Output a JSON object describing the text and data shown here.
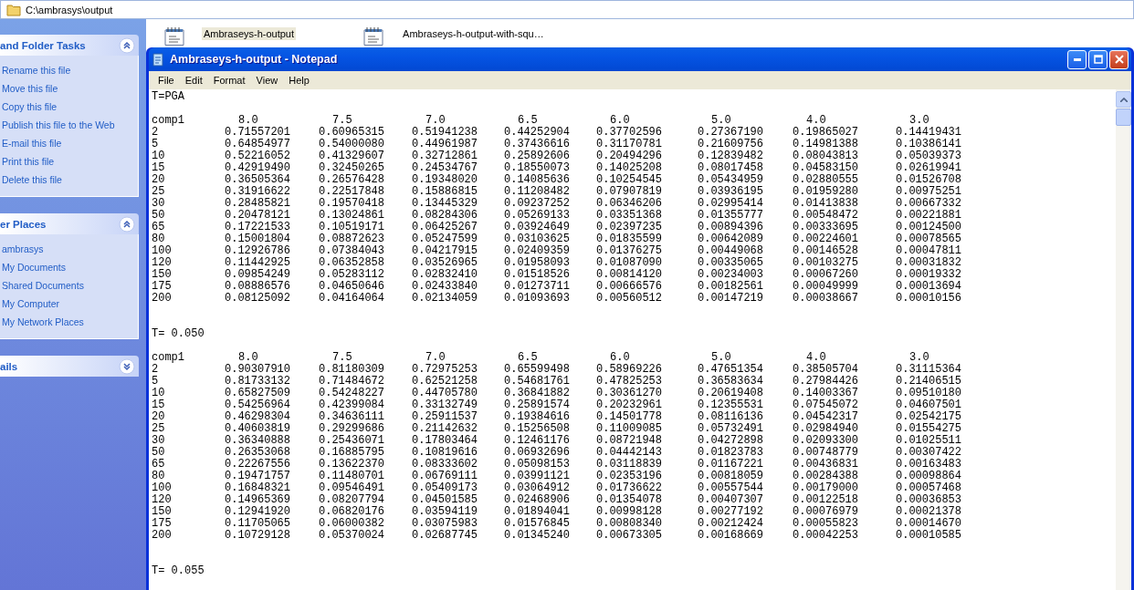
{
  "address_bar": {
    "path": "C:\\ambrasys\\output"
  },
  "task_panes": [
    {
      "title": "and Folder Tasks",
      "expanded": true,
      "items": [
        "Rename this file",
        "Move this file",
        "Copy this file",
        "Publish this file to the Web",
        "E-mail this file",
        "Print this file",
        "Delete this file"
      ]
    },
    {
      "title": "er Places",
      "expanded": true,
      "items": [
        "ambrasys",
        "My Documents",
        "Shared Documents",
        "My Computer",
        "My Network Places"
      ]
    },
    {
      "title": "ails",
      "expanded": false
    }
  ],
  "files": [
    {
      "name": "Ambraseys-h-output",
      "selected": true
    },
    {
      "name": "Ambraseys-h-output-with-squ…",
      "selected": false
    }
  ],
  "notepad": {
    "title": "Ambraseys-h-output - Notepad",
    "menu": [
      "File",
      "Edit",
      "Format",
      "View",
      "Help"
    ],
    "blocks": [
      {
        "heading": "T=PGA",
        "columns": [
          "comp1",
          "8.0",
          "7.5",
          "7.0",
          "6.5",
          "6.0",
          "5.0",
          "4.0",
          "3.0"
        ],
        "rows": [
          [
            "2",
            "0.71557201",
            "0.60965315",
            "0.51941238",
            "0.44252904",
            "0.37702596",
            "0.27367190",
            "0.19865027",
            "0.14419431"
          ],
          [
            "5",
            "0.64854977",
            "0.54000080",
            "0.44961987",
            "0.37436616",
            "0.31170781",
            "0.21609756",
            "0.14981388",
            "0.10386141"
          ],
          [
            "10",
            "0.52216052",
            "0.41329607",
            "0.32712861",
            "0.25892606",
            "0.20494296",
            "0.12839482",
            "0.08043813",
            "0.05039373"
          ],
          [
            "15",
            "0.42919490",
            "0.32450265",
            "0.24534767",
            "0.18550073",
            "0.14025208",
            "0.08017458",
            "0.04583150",
            "0.02619941"
          ],
          [
            "20",
            "0.36505364",
            "0.26576428",
            "0.19348020",
            "0.14085636",
            "0.10254545",
            "0.05434959",
            "0.02880555",
            "0.01526708"
          ],
          [
            "25",
            "0.31916622",
            "0.22517848",
            "0.15886815",
            "0.11208482",
            "0.07907819",
            "0.03936195",
            "0.01959280",
            "0.00975251"
          ],
          [
            "30",
            "0.28485821",
            "0.19570418",
            "0.13445329",
            "0.09237252",
            "0.06346206",
            "0.02995414",
            "0.01413838",
            "0.00667332"
          ],
          [
            "50",
            "0.20478121",
            "0.13024861",
            "0.08284306",
            "0.05269133",
            "0.03351368",
            "0.01355777",
            "0.00548472",
            "0.00221881"
          ],
          [
            "65",
            "0.17221533",
            "0.10519171",
            "0.06425267",
            "0.03924649",
            "0.02397235",
            "0.00894396",
            "0.00333695",
            "0.00124500"
          ],
          [
            "80",
            "0.15001804",
            "0.08872623",
            "0.05247599",
            "0.03103625",
            "0.01835599",
            "0.00642089",
            "0.00224601",
            "0.00078565"
          ],
          [
            "100",
            "0.12926786",
            "0.07384043",
            "0.04217915",
            "0.02409359",
            "0.01376275",
            "0.00449068",
            "0.00146528",
            "0.00047811"
          ],
          [
            "120",
            "0.11442925",
            "0.06352858",
            "0.03526965",
            "0.01958093",
            "0.01087090",
            "0.00335065",
            "0.00103275",
            "0.00031832"
          ],
          [
            "150",
            "0.09854249",
            "0.05283112",
            "0.02832410",
            "0.01518526",
            "0.00814120",
            "0.00234003",
            "0.00067260",
            "0.00019332"
          ],
          [
            "175",
            "0.08886576",
            "0.04650646",
            "0.02433840",
            "0.01273711",
            "0.00666576",
            "0.00182561",
            "0.00049999",
            "0.00013694"
          ],
          [
            "200",
            "0.08125092",
            "0.04164064",
            "0.02134059",
            "0.01093693",
            "0.00560512",
            "0.00147219",
            "0.00038667",
            "0.00010156"
          ]
        ]
      },
      {
        "heading": "T= 0.050",
        "columns": [
          "comp1",
          "8.0",
          "7.5",
          "7.0",
          "6.5",
          "6.0",
          "5.0",
          "4.0",
          "3.0"
        ],
        "rows": [
          [
            "2",
            "0.90307910",
            "0.81180309",
            "0.72975253",
            "0.65599498",
            "0.58969226",
            "0.47651354",
            "0.38505704",
            "0.31115364"
          ],
          [
            "5",
            "0.81733132",
            "0.71484672",
            "0.62521258",
            "0.54681761",
            "0.47825253",
            "0.36583634",
            "0.27984426",
            "0.21406515"
          ],
          [
            "10",
            "0.65827509",
            "0.54248227",
            "0.44705780",
            "0.36841882",
            "0.30361270",
            "0.20619408",
            "0.14003367",
            "0.09510180"
          ],
          [
            "15",
            "0.54256964",
            "0.42399084",
            "0.33132749",
            "0.25891574",
            "0.20232961",
            "0.12355531",
            "0.07545072",
            "0.04607501"
          ],
          [
            "20",
            "0.46298304",
            "0.34636111",
            "0.25911537",
            "0.19384616",
            "0.14501778",
            "0.08116136",
            "0.04542317",
            "0.02542175"
          ],
          [
            "25",
            "0.40603819",
            "0.29299686",
            "0.21142632",
            "0.15256508",
            "0.11009085",
            "0.05732491",
            "0.02984940",
            "0.01554275"
          ],
          [
            "30",
            "0.36340888",
            "0.25436071",
            "0.17803464",
            "0.12461176",
            "0.08721948",
            "0.04272898",
            "0.02093300",
            "0.01025511"
          ],
          [
            "50",
            "0.26353068",
            "0.16885795",
            "0.10819616",
            "0.06932696",
            "0.04442143",
            "0.01823783",
            "0.00748779",
            "0.00307422"
          ],
          [
            "65",
            "0.22267556",
            "0.13622370",
            "0.08333602",
            "0.05098153",
            "0.03118839",
            "0.01167221",
            "0.00436831",
            "0.00163483"
          ],
          [
            "80",
            "0.19471757",
            "0.11480701",
            "0.06769111",
            "0.03991121",
            "0.02353196",
            "0.00818059",
            "0.00284388",
            "0.00098864"
          ],
          [
            "100",
            "0.16848321",
            "0.09546491",
            "0.05409173",
            "0.03064912",
            "0.01736622",
            "0.00557544",
            "0.00179000",
            "0.00057468"
          ],
          [
            "120",
            "0.14965369",
            "0.08207794",
            "0.04501585",
            "0.02468906",
            "0.01354078",
            "0.00407307",
            "0.00122518",
            "0.00036853"
          ],
          [
            "150",
            "0.12941920",
            "0.06820176",
            "0.03594119",
            "0.01894041",
            "0.00998128",
            "0.00277192",
            "0.00076979",
            "0.00021378"
          ],
          [
            "175",
            "0.11705065",
            "0.06000382",
            "0.03075983",
            "0.01576845",
            "0.00808340",
            "0.00212424",
            "0.00055823",
            "0.00014670"
          ],
          [
            "200",
            "0.10729128",
            "0.05370024",
            "0.02687745",
            "0.01345240",
            "0.00673305",
            "0.00168669",
            "0.00042253",
            "0.00010585"
          ]
        ]
      },
      {
        "heading": "T= 0.055"
      }
    ]
  }
}
